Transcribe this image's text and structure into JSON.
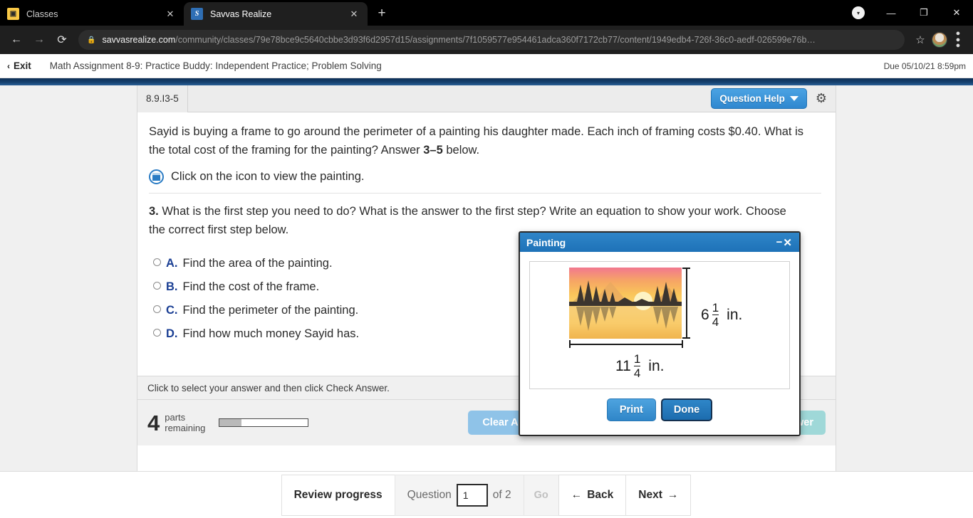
{
  "browser": {
    "tabs": [
      {
        "title": "Classes",
        "favicon": "classes-icon",
        "favicon_letter": "▣",
        "active": false
      },
      {
        "title": "Savvas Realize",
        "favicon": "savvas-icon",
        "favicon_letter": "S",
        "active": true
      }
    ],
    "new_tab_label": "+",
    "window_controls": {
      "update_label": "▾",
      "minimize_label": "—",
      "maximize_label": "❐",
      "close_label": "✕"
    },
    "nav": {
      "back_label": "←",
      "forward_label": "→",
      "reload_label": "⟳"
    },
    "address": {
      "lock_label": "🔒",
      "host": "savvasrealize.com",
      "path": "/community/classes/79e78bce9c5640cbbe3d93f6d2957d15/assignments/7f1059577e954461adca360f7172cb77/content/1949edb4-726f-36c0-aedf-026599e76b…"
    },
    "bookmark_label": "☆",
    "menu_label": "⋮"
  },
  "app_header": {
    "exit_chevron": "‹",
    "exit_label": "Exit",
    "assignment_title": "Math Assignment 8-9: Practice Buddy: Independent Practice; Problem Solving",
    "due_label": "Due 05/10/21 8:59pm"
  },
  "question": {
    "id": "8.9.I3-5",
    "help_label": "Question Help",
    "settings_icon": "⚙",
    "prompt_part1": "Sayid is buying a frame to go around the perimeter of a painting his daughter made. Each inch of framing costs $0.40. What is the total cost of the framing for the painting? Answer ",
    "prompt_bold": "3–5",
    "prompt_part2": " below.",
    "view_icon_text": "Click on the icon to view the painting.",
    "subquestion_number": "3.",
    "subquestion_text": " What is the first step you need to do? What is the answer to the first step? Write an equation to show your work. Choose the correct first step below.",
    "choices": [
      {
        "letter": "A.",
        "text": "Find the area of the painting."
      },
      {
        "letter": "B.",
        "text": "Find the cost of the frame."
      },
      {
        "letter": "C.",
        "text": "Find the perimeter of the painting."
      },
      {
        "letter": "D.",
        "text": "Find how much money Sayid has."
      }
    ],
    "hint": "Click to select your answer and then click Check Answer.",
    "parts_number": "4",
    "parts_label_line1": "parts",
    "parts_label_line2": "remaining",
    "progress_percent": 25,
    "clear_all_label": "Clear All",
    "check_answer_label": "Check Answer"
  },
  "modal": {
    "title": "Painting",
    "minimize_label": "−",
    "close_label": "✕",
    "height_whole": "6",
    "height_num": "1",
    "height_den": "4",
    "height_unit": "in.",
    "width_whole": "11",
    "width_num": "1",
    "width_den": "4",
    "width_unit": "in.",
    "print_label": "Print",
    "done_label": "Done"
  },
  "bottom_nav": {
    "review_label": "Review progress",
    "question_label": "Question",
    "question_value": "1",
    "of_label": "of 2",
    "go_label": "Go",
    "back_label": "Back",
    "back_arrow": "←",
    "next_label": "Next",
    "next_arrow": "→"
  },
  "colors": {
    "accent_blue": "#2e87cf",
    "header_rule": "#15406e",
    "choice_letter": "#1b3f94",
    "clear_btn": "#8fc3e8",
    "check_btn": "#9fd8d8"
  }
}
